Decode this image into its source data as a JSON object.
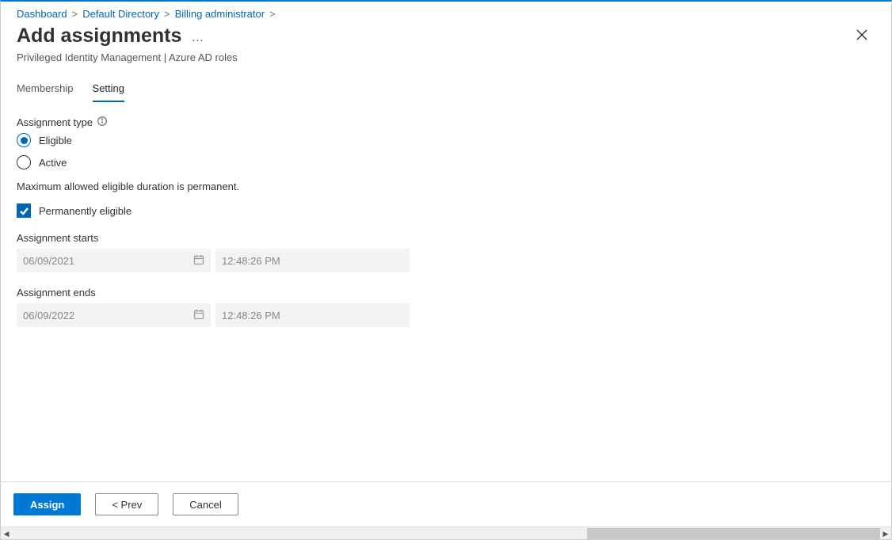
{
  "breadcrumb": {
    "items": [
      {
        "label": "Dashboard"
      },
      {
        "label": "Default Directory"
      },
      {
        "label": "Billing administrator"
      }
    ]
  },
  "header": {
    "title": "Add assignments",
    "subtitle": "Privileged Identity Management | Azure AD roles"
  },
  "tabs": {
    "membership": "Membership",
    "setting": "Setting"
  },
  "form": {
    "assignment_type_label": "Assignment type",
    "eligible_label": "Eligible",
    "active_label": "Active",
    "duration_helper": "Maximum allowed eligible duration is permanent.",
    "permanent_label": "Permanently eligible",
    "starts_label": "Assignment starts",
    "starts_date": "06/09/2021",
    "starts_time": "12:48:26 PM",
    "ends_label": "Assignment ends",
    "ends_date": "06/09/2022",
    "ends_time": "12:48:26 PM"
  },
  "footer": {
    "assign": "Assign",
    "prev": "<  Prev",
    "cancel": "Cancel"
  }
}
